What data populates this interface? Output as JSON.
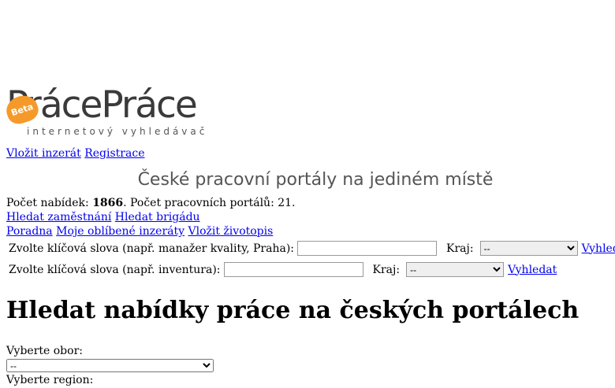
{
  "logo": {
    "wordmark": "PrácePráce",
    "tagline": "internetový vyhledávač",
    "badge": "Beta"
  },
  "top_links": [
    "Vložit inzerát",
    "Registrace"
  ],
  "slogan": "České pracovní portály na jediném místě",
  "stats": {
    "offers_label": "Počet nabídek:",
    "offers_value": "1866",
    "portals_text": ". Počet pracovních portálů: 21."
  },
  "links_row2": [
    "Hledat zaměstnání",
    "Hledat brigádu"
  ],
  "links_row3": [
    "Poradna",
    "Moje oblíbené inzeráty",
    "Vložit životopis"
  ],
  "search_jobs": {
    "label": "Zvolte klíčová slova (např. manažer kvality, Praha):",
    "value": "",
    "kraj_label": "Kraj:",
    "kraj_selected": "--",
    "button": "Vyhledat"
  },
  "search_brigady": {
    "label": "Zvolte klíčová slova (např. inventura):",
    "value": "",
    "kraj_label": "Kraj:",
    "kraj_selected": "--",
    "button": "Vyhledat"
  },
  "heading": "Hledat nabídky práce na českých portálech",
  "obor": {
    "label": "Vyberte obor:",
    "selected": "--"
  },
  "region": {
    "label": "Vyberte region:"
  },
  "colors": {
    "link": "#0000ee",
    "badge": "#f59a2a",
    "slogan": "#555555"
  }
}
